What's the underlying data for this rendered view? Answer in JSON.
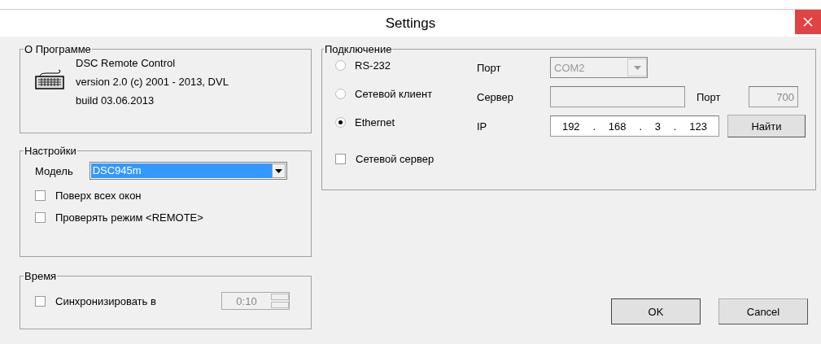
{
  "window": {
    "title": "Settings"
  },
  "about": {
    "legend": "О Программе",
    "lines": [
      "DSC Remote Control",
      "version 2.0  (c) 2001 - 2013, DVL",
      "build  03.06.2013"
    ]
  },
  "settings": {
    "legend": "Настройки",
    "model_label": "Модель",
    "model_value": "DSC945m",
    "checkboxes": [
      {
        "label": "Поверх всех окон",
        "checked": false
      },
      {
        "label": "Проверять режим <REMOTE>",
        "checked": false
      }
    ]
  },
  "time": {
    "legend": "Время",
    "sync": {
      "label": "Синхронизировать в",
      "checked": false
    },
    "time_value": "0:10",
    "disabled": true
  },
  "connection": {
    "legend": "Подключение",
    "modes": [
      {
        "label": "RS-232",
        "selected": false
      },
      {
        "label": "Сетевой клиент",
        "selected": false
      },
      {
        "label": "Ethernet",
        "selected": true
      }
    ],
    "port_label": "Порт",
    "port_value": "COM2",
    "port_disabled": true,
    "server_label": "Сервер",
    "server_disabled": true,
    "server_port_label": "Порт",
    "server_port_value": "700",
    "ip_label": "IP",
    "ip_parts": [
      "192",
      ".",
      "168",
      ".",
      "3",
      ".",
      "123"
    ],
    "find_button": "Найти",
    "server_checkbox": {
      "label": "Сетевой сервер",
      "checked": false
    }
  },
  "buttons": [
    "OK",
    "Cancel"
  ]
}
